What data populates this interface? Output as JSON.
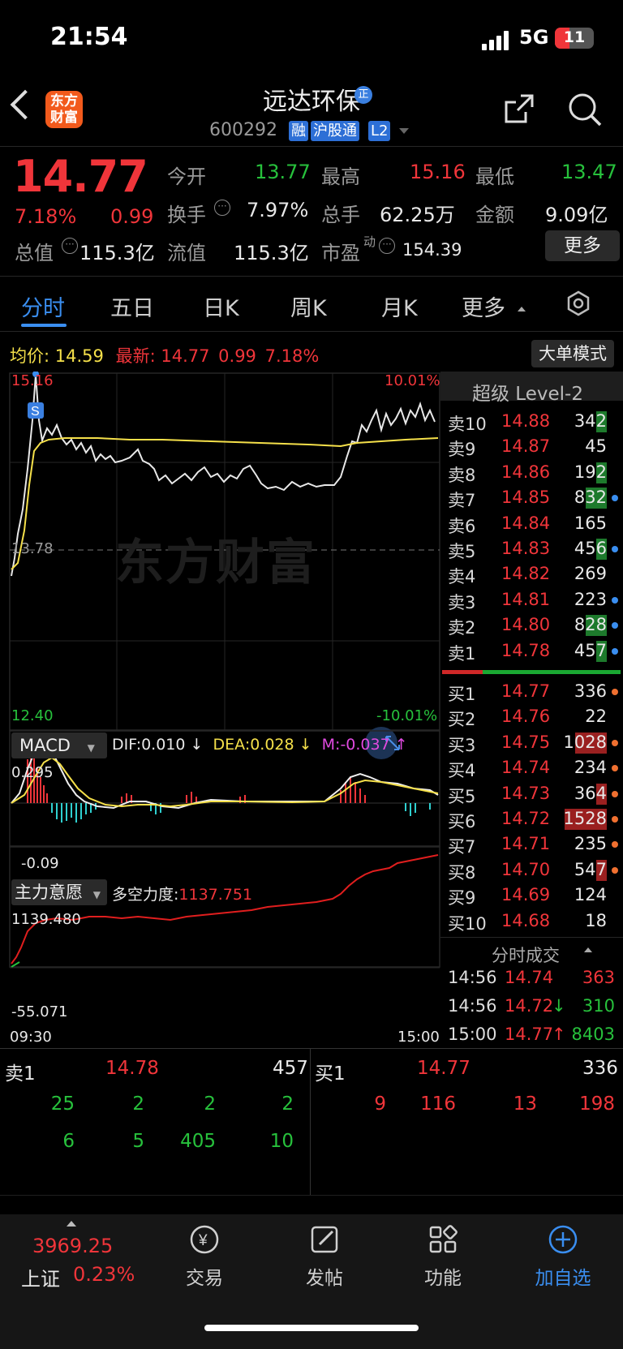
{
  "status": {
    "time": "21:54",
    "network": "5G",
    "battery": "11"
  },
  "header": {
    "logo": [
      "东方",
      "财富"
    ],
    "title": "远达环保",
    "title_badge": "正",
    "code": "600292",
    "tags": [
      "融",
      "沪股通",
      "L2"
    ]
  },
  "quote": {
    "price": "14.77",
    "change_pct": "7.18%",
    "change": "0.99",
    "open_label": "今开",
    "open": "13.77",
    "high_label": "最高",
    "high": "15.16",
    "low_label": "最低",
    "low": "13.47",
    "turnover_label": "换手",
    "turnover": "7.97%",
    "volume_label": "总手",
    "volume": "62.25万",
    "amount_label": "金额",
    "amount": "9.09亿",
    "mktcap_label": "总值",
    "mktcap": "115.3亿",
    "float_label": "流值",
    "float": "115.3亿",
    "pe_label": "市盈",
    "pe_sup": "动",
    "pe": "154.39",
    "more": "更多"
  },
  "tabs": [
    "分时",
    "五日",
    "日K",
    "周K",
    "月K",
    "更多"
  ],
  "chart": {
    "avg_label": "均价:",
    "avg": "14.59",
    "latest_label": "最新:",
    "latest": "14.77",
    "latest_change": "0.99",
    "latest_pct": "7.18%",
    "mode": "大单模式",
    "y_top": "15.16",
    "y_mid": "13.78",
    "y_bottom": "12.40",
    "pct_top": "10.01%",
    "pct_bottom": "-10.01%",
    "watermark": "东方财富",
    "marker": "S",
    "macd_label": "MACD",
    "dif_label": "DIF:",
    "dif": "0.010",
    "dea_label": "DEA:",
    "dea": "0.028",
    "m_label": "M:",
    "m": "-0.037",
    "macd_top": "0.295",
    "macd_bottom": "-0.09",
    "zlyy_label": "主力意愿",
    "dkld_label": "多空力度:",
    "dkld": "1137.751",
    "zlyy_top": "1139.480",
    "zlyy_bottom": "-55.071",
    "t_start": "09:30",
    "t_end": "15:00"
  },
  "chart_data": {
    "type": "line",
    "x": [
      "09:30",
      "15:00"
    ],
    "ylim": [
      12.4,
      15.16
    ],
    "y_ref": 13.78,
    "series": [],
    "macd": {
      "dif": 0.01,
      "dea": 0.028,
      "m": -0.037,
      "ylim": [
        -0.09,
        0.295
      ]
    },
    "zlyy": {
      "ylim": [
        -55.071,
        1139.48
      ],
      "last": 1137.751
    }
  },
  "orderbook": {
    "title": "超级 Level-2",
    "asks": [
      {
        "name": "卖10",
        "price": "14.88",
        "vol": "342",
        "hl": 1,
        "dot": ""
      },
      {
        "name": "卖9",
        "price": "14.87",
        "vol": "45",
        "hl": 0,
        "dot": ""
      },
      {
        "name": "卖8",
        "price": "14.86",
        "vol": "192",
        "hl": 1,
        "dot": ""
      },
      {
        "name": "卖7",
        "price": "14.85",
        "vol": "832",
        "hl": 2,
        "dot": "blue"
      },
      {
        "name": "卖6",
        "price": "14.84",
        "vol": "165",
        "hl": 0,
        "dot": ""
      },
      {
        "name": "卖5",
        "price": "14.83",
        "vol": "456",
        "hl": 1,
        "dot": "blue"
      },
      {
        "name": "卖4",
        "price": "14.82",
        "vol": "269",
        "hl": 0,
        "dot": ""
      },
      {
        "name": "卖3",
        "price": "14.81",
        "vol": "223",
        "hl": 0,
        "dot": "blue"
      },
      {
        "name": "卖2",
        "price": "14.80",
        "vol": "828",
        "hl": 2,
        "dot": "blue"
      },
      {
        "name": "卖1",
        "price": "14.78",
        "vol": "457",
        "hl": 1,
        "dot": "blue"
      }
    ],
    "bids": [
      {
        "name": "买1",
        "price": "14.77",
        "vol": "336",
        "hl": 0,
        "dot": "orange"
      },
      {
        "name": "买2",
        "price": "14.76",
        "vol": "22",
        "hl": 0,
        "dot": ""
      },
      {
        "name": "买3",
        "price": "14.75",
        "vol": "1028",
        "hl": 3,
        "dot": "orange"
      },
      {
        "name": "买4",
        "price": "14.74",
        "vol": "234",
        "hl": 0,
        "dot": "orange"
      },
      {
        "name": "买5",
        "price": "14.73",
        "vol": "364",
        "hl": 1,
        "dot": "orange"
      },
      {
        "name": "买6",
        "price": "14.72",
        "vol": "1528",
        "hl": 4,
        "dot": "orange"
      },
      {
        "name": "买7",
        "price": "14.71",
        "vol": "235",
        "hl": 0,
        "dot": "orange"
      },
      {
        "name": "买8",
        "price": "14.70",
        "vol": "547",
        "hl": 1,
        "dot": "orange"
      },
      {
        "name": "买9",
        "price": "14.69",
        "vol": "124",
        "hl": 0,
        "dot": ""
      },
      {
        "name": "买10",
        "price": "14.68",
        "vol": "18",
        "hl": 0,
        "dot": ""
      }
    ],
    "trades_title": "分时成交",
    "trades": [
      {
        "time": "14:56",
        "price": "14.74",
        "arrow": "",
        "vol": "363",
        "color": "red"
      },
      {
        "time": "14:56",
        "price": "14.72",
        "arrow": "↓",
        "vol": "310",
        "color": "green"
      },
      {
        "time": "15:00",
        "price": "14.77",
        "arrow": "↑",
        "vol": "8403",
        "color": "green"
      }
    ]
  },
  "bottom": {
    "sell_label": "卖1",
    "sell_price": "14.78",
    "sell_vol": "457",
    "buy_label": "买1",
    "buy_price": "14.77",
    "buy_vol": "336",
    "sell_row1": [
      "25",
      "2",
      "2",
      "2"
    ],
    "sell_row2": [
      "6",
      "5",
      "405",
      "10"
    ],
    "buy_row1": [
      "9",
      "116",
      "13",
      "198"
    ]
  },
  "tabbar": {
    "index_value": "3969.25",
    "index_name": "上证",
    "index_pct": "0.23%",
    "items": [
      "交易",
      "发帖",
      "功能",
      "加自选"
    ]
  },
  "colors": {
    "red": "#f0353a",
    "green": "#27c13c",
    "blue": "#3a8ef0",
    "yellow": "#f5e04a"
  }
}
